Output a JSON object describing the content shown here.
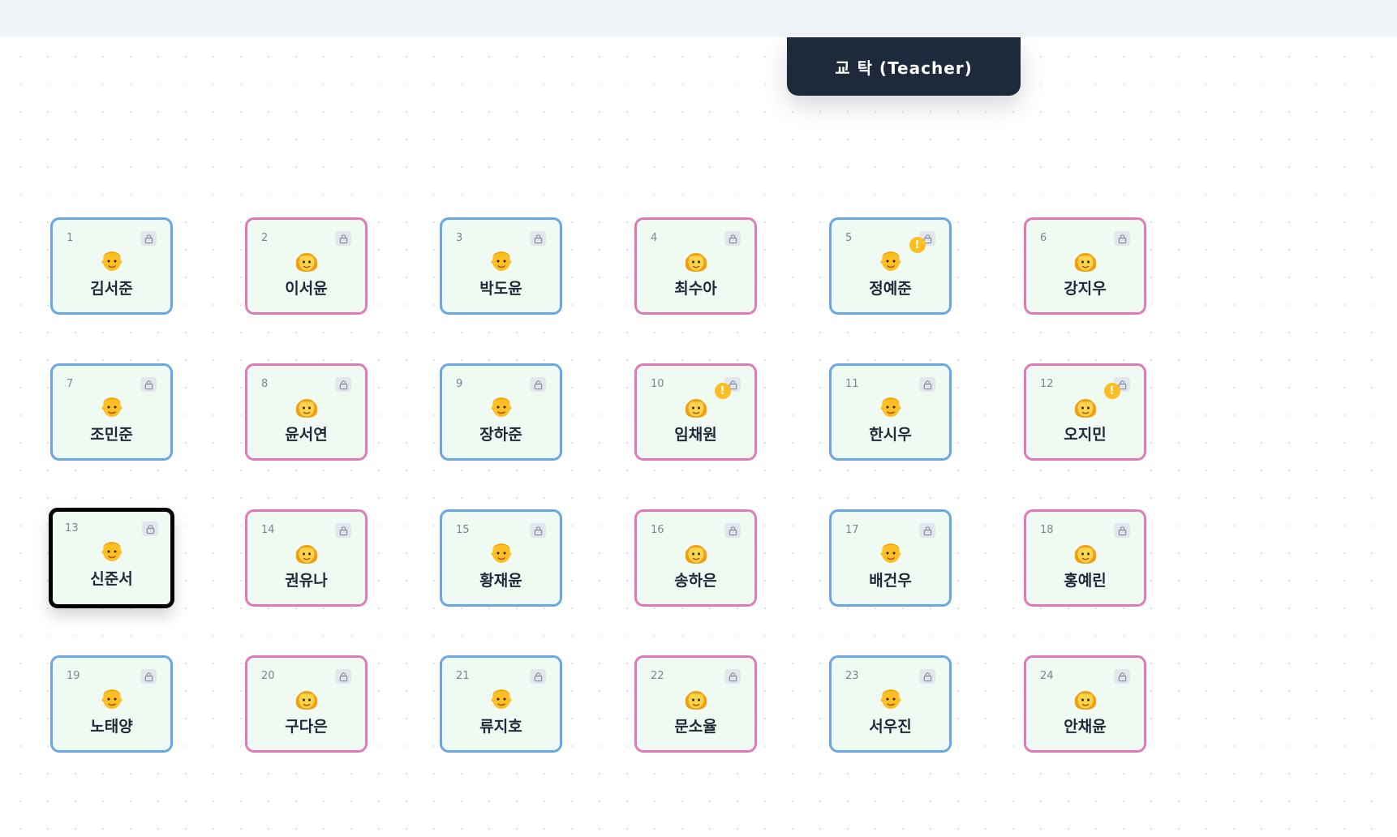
{
  "teacher_desk": {
    "label": "교 탁 (Teacher)"
  },
  "colors": {
    "male_border": "#6aa6e6",
    "female_border": "#e27bb5",
    "desk_fill": "#effaf3",
    "selected_border": "#000000",
    "alert": "#fbbf24",
    "teacher_desk": "#1e293b"
  },
  "icons": {
    "lock": "lock-icon",
    "alert": "alert-icon",
    "avatar_male": "boy-avatar-icon",
    "avatar_female": "girl-avatar-icon"
  },
  "alert_symbol": "!",
  "seats": [
    {
      "number": "1",
      "name": "김서준",
      "gender": "male",
      "alert": false,
      "selected": false
    },
    {
      "number": "2",
      "name": "이서윤",
      "gender": "female",
      "alert": false,
      "selected": false
    },
    {
      "number": "3",
      "name": "박도윤",
      "gender": "male",
      "alert": false,
      "selected": false
    },
    {
      "number": "4",
      "name": "최수아",
      "gender": "female",
      "alert": false,
      "selected": false
    },
    {
      "number": "5",
      "name": "정예준",
      "gender": "male",
      "alert": true,
      "selected": false
    },
    {
      "number": "6",
      "name": "강지우",
      "gender": "female",
      "alert": false,
      "selected": false
    },
    {
      "number": "7",
      "name": "조민준",
      "gender": "male",
      "alert": false,
      "selected": false
    },
    {
      "number": "8",
      "name": "윤서연",
      "gender": "female",
      "alert": false,
      "selected": false
    },
    {
      "number": "9",
      "name": "장하준",
      "gender": "male",
      "alert": false,
      "selected": false
    },
    {
      "number": "10",
      "name": "임채원",
      "gender": "female",
      "alert": true,
      "selected": false
    },
    {
      "number": "11",
      "name": "한시우",
      "gender": "male",
      "alert": false,
      "selected": false
    },
    {
      "number": "12",
      "name": "오지민",
      "gender": "female",
      "alert": true,
      "selected": false
    },
    {
      "number": "13",
      "name": "신준서",
      "gender": "male",
      "alert": false,
      "selected": true
    },
    {
      "number": "14",
      "name": "권유나",
      "gender": "female",
      "alert": false,
      "selected": false
    },
    {
      "number": "15",
      "name": "황재윤",
      "gender": "male",
      "alert": false,
      "selected": false
    },
    {
      "number": "16",
      "name": "송하은",
      "gender": "female",
      "alert": false,
      "selected": false
    },
    {
      "number": "17",
      "name": "배건우",
      "gender": "male",
      "alert": false,
      "selected": false
    },
    {
      "number": "18",
      "name": "홍예린",
      "gender": "female",
      "alert": false,
      "selected": false
    },
    {
      "number": "19",
      "name": "노태양",
      "gender": "male",
      "alert": false,
      "selected": false
    },
    {
      "number": "20",
      "name": "구다은",
      "gender": "female",
      "alert": false,
      "selected": false
    },
    {
      "number": "21",
      "name": "류지호",
      "gender": "male",
      "alert": false,
      "selected": false
    },
    {
      "number": "22",
      "name": "문소율",
      "gender": "female",
      "alert": false,
      "selected": false
    },
    {
      "number": "23",
      "name": "서우진",
      "gender": "male",
      "alert": false,
      "selected": false
    },
    {
      "number": "24",
      "name": "안채윤",
      "gender": "female",
      "alert": false,
      "selected": false
    }
  ]
}
